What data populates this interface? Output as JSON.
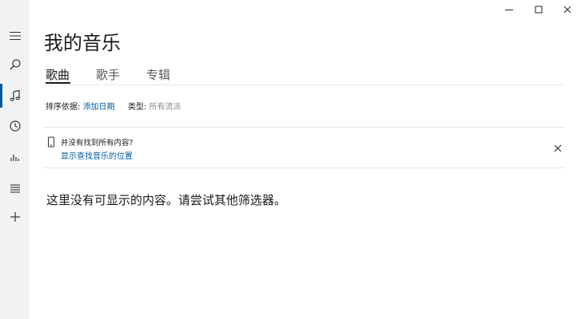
{
  "page": {
    "title": "我的音乐"
  },
  "tabs": [
    {
      "label": "歌曲",
      "active": true
    },
    {
      "label": "歌手",
      "active": false
    },
    {
      "label": "专辑",
      "active": false
    }
  ],
  "sort": {
    "label": "排序依据:",
    "value": "添加日期"
  },
  "genre": {
    "label": "类型:",
    "value": "所有流派"
  },
  "notice": {
    "text": "并没有找到所有内容?",
    "link": "显示查找音乐的位置"
  },
  "empty_message": "这里没有可显示的内容。请尝试其他筛选器。",
  "sidebar": {
    "items": [
      {
        "icon": "hamburger-menu-icon"
      },
      {
        "icon": "search-icon"
      },
      {
        "icon": "music-note-icon",
        "active": true
      },
      {
        "icon": "recent-clock-icon"
      },
      {
        "icon": "now-playing-bars-icon"
      },
      {
        "icon": "playlist-icon"
      },
      {
        "icon": "add-icon"
      }
    ]
  },
  "colors": {
    "accent": "#005a9e",
    "sidebar_bg": "#f2f2f2",
    "muted_text": "#8a8a8a"
  }
}
